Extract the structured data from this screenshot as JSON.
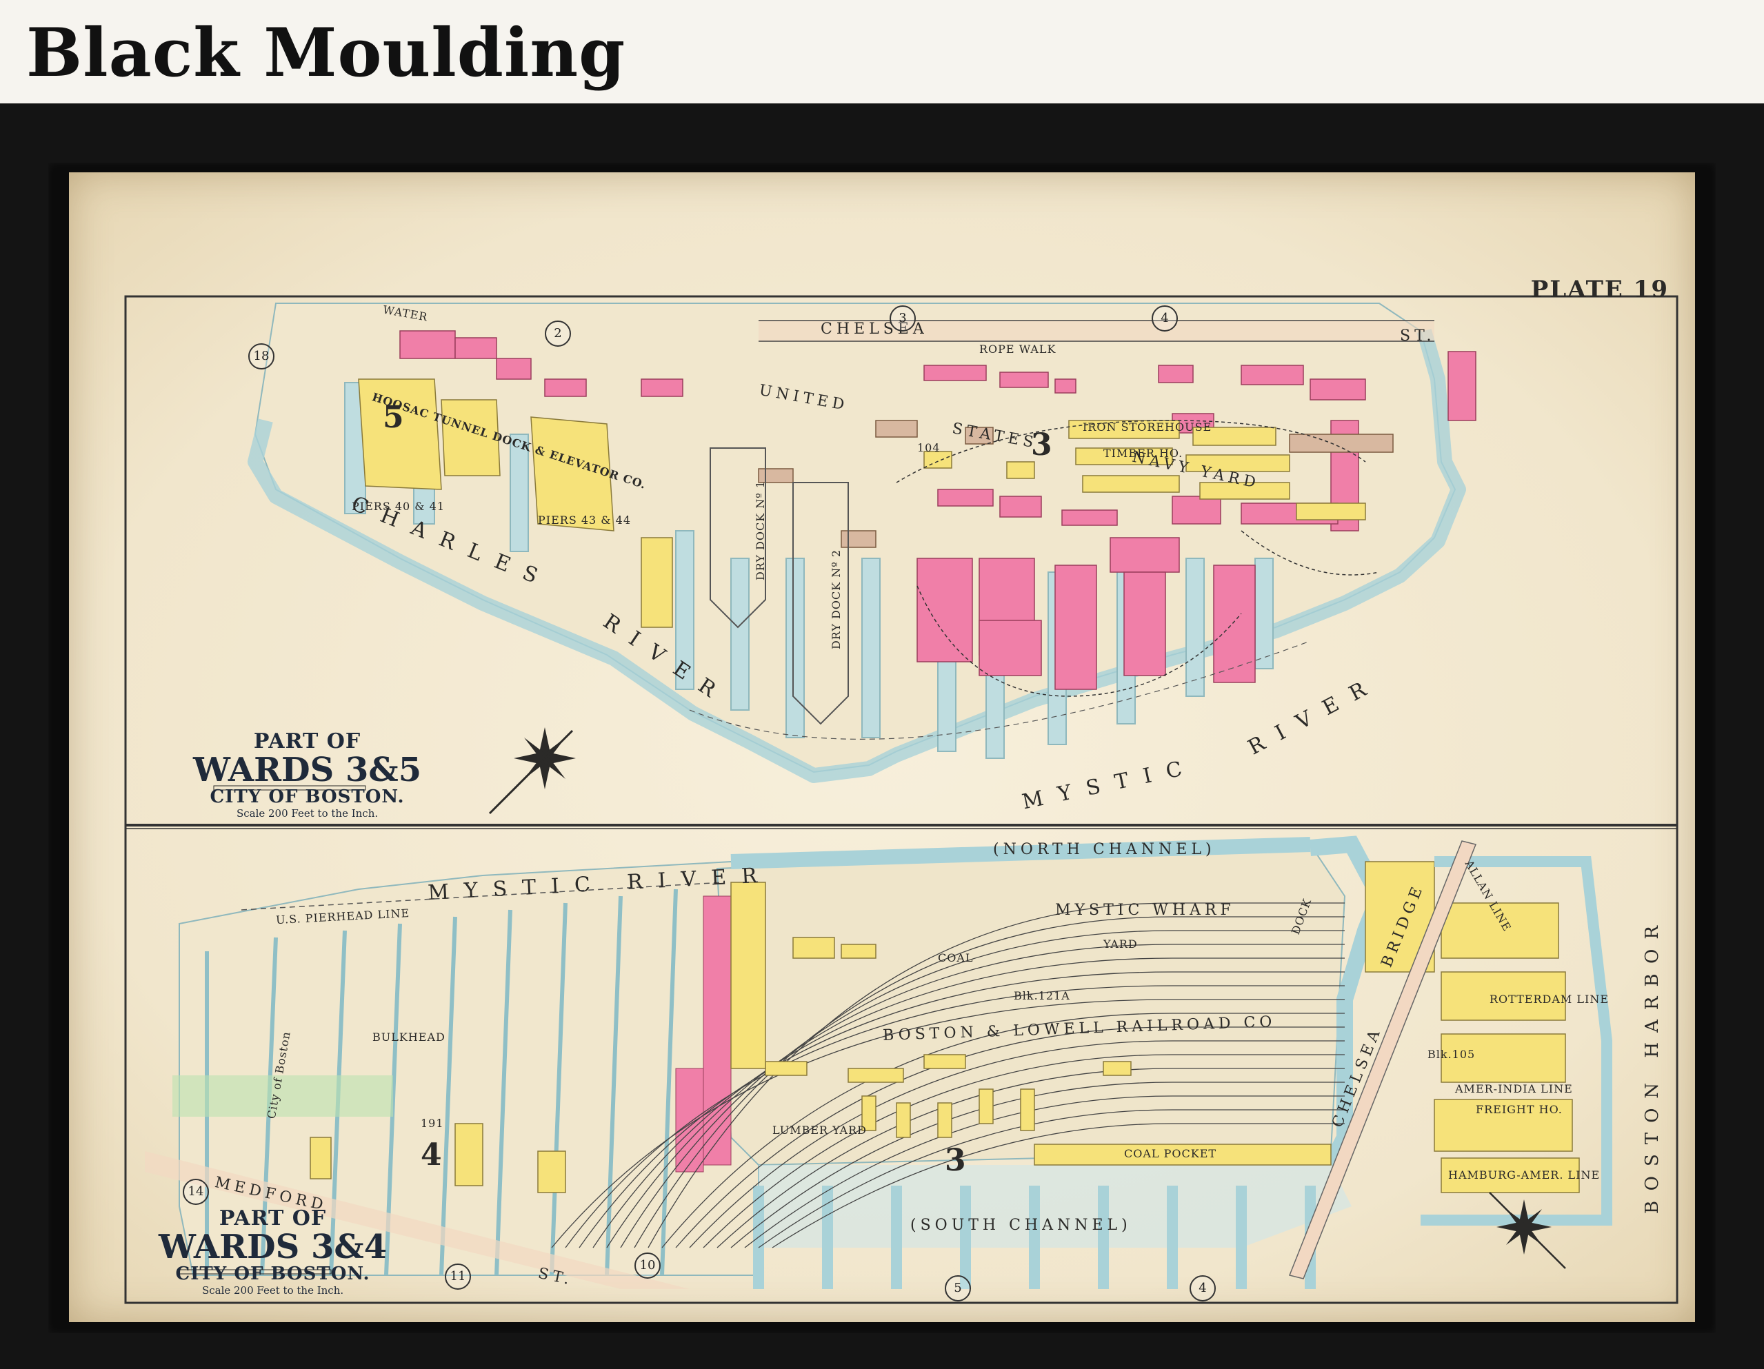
{
  "header": {
    "title": "Black Moulding"
  },
  "map": {
    "plate": "PLATE 19",
    "upper": {
      "ward_pre": "PART OF",
      "ward_main": "WARDS 3&5",
      "city": "CITY OF BOSTON.",
      "scale": "Scale 200 Feet to the Inch.",
      "river1": "CHARLES",
      "river2": "RIVER",
      "river3": "MYSTIC",
      "river4": "RIVER",
      "yard1": "UNITED",
      "yard2": "STATES",
      "yard3": "NAVY YARD",
      "street": "CHELSEA",
      "street_end": "ST.",
      "street2": "WATER",
      "dock": "HOOSAC TUNNEL DOCK & ELEVATOR CO.",
      "ward_num": "3",
      "ward_num2": "5",
      "circle_18": "18",
      "circle_2": "2",
      "circle_3": "3",
      "circle_4": "4",
      "piers1": "PIERS 40 & 41",
      "piers2": "PIERS 43 & 44",
      "block": "104",
      "timber": "TIMBER HO.",
      "iron": "IRON STOREHOUSE",
      "rope": "ROPE WALK",
      "drydock1": "DRY DOCK Nº 1",
      "drydock2": "DRY DOCK Nº 2"
    },
    "lower": {
      "ward_pre": "PART OF",
      "ward_main": "WARDS 3&4",
      "city": "CITY OF BOSTON.",
      "scale": "Scale 200 Feet to the Inch.",
      "river": "MYSTIC RIVER",
      "north_channel": "(NORTH CHANNEL)",
      "south_channel": "(SOUTH CHANNEL)",
      "harbor": "BOSTON HARBOR",
      "wharf": "MYSTIC WHARF",
      "railroad": "BOSTON & LOWELL RAILROAD CO",
      "blk121": "Blk.121A",
      "blk105": "Blk.105",
      "coal_pocket": "COAL POCKET",
      "lumber": "LUMBER YARD",
      "medford": "MEDFORD",
      "st": "ST.",
      "chelsea": "CHELSEA",
      "bridge": "BRIDGE",
      "bulkhead": "BULKHEAD",
      "pierhead": "U.S. PIERHEAD LINE",
      "ward_num": "3",
      "ward_num2": "4",
      "circle_14": "14",
      "circle_11": "11",
      "circle_10": "10",
      "circle_5": "5",
      "circle_4": "4",
      "allan": "ALLAN LINE",
      "rotterdam": "ROTTERDAM LINE",
      "amer_india": "AMER-INDIA LINE",
      "freight": "FREIGHT HO.",
      "hamburg": "HAMBURG-AMER. LINE",
      "yard": "YARD",
      "coal": "COAL",
      "dock": "DOCK",
      "city_of_boston": "City of Boston",
      "blk191": "191"
    }
  },
  "colors": {
    "paper": "#f4ead2",
    "water": "#bfdde0",
    "pink": "#f07fa8",
    "yellow": "#f6e27a",
    "frame": "#141414"
  }
}
